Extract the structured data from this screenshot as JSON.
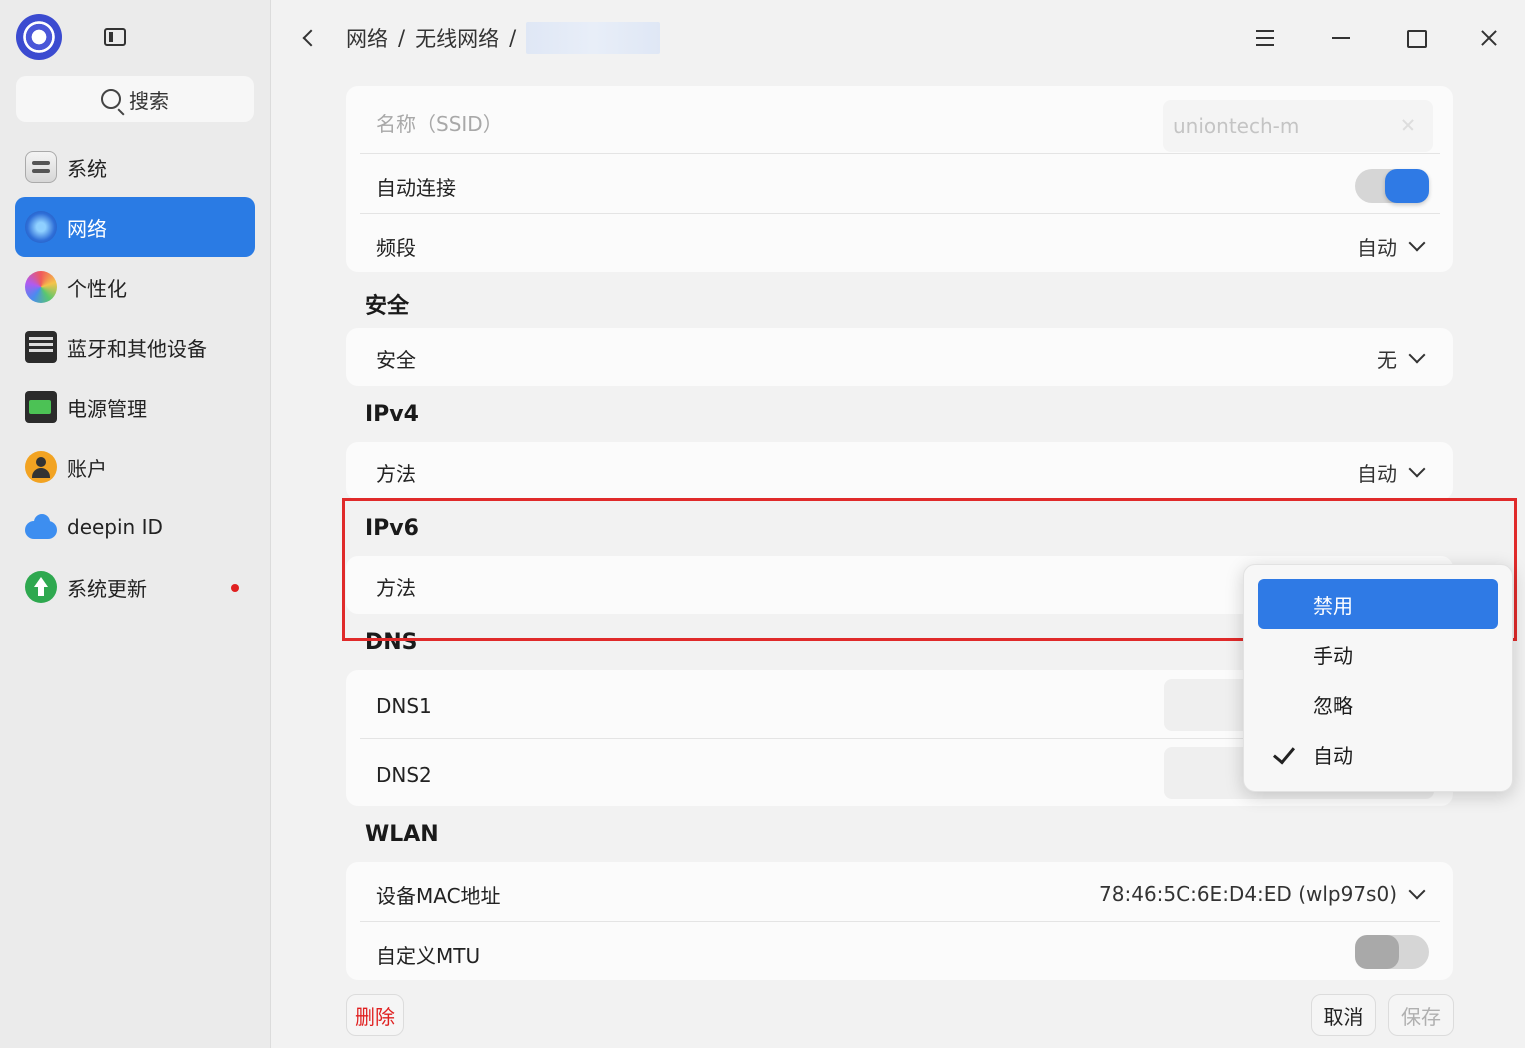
{
  "sidebar": {
    "search_label": "搜索",
    "items": [
      {
        "label": "系统"
      },
      {
        "label": "网络"
      },
      {
        "label": "个性化"
      },
      {
        "label": "蓝牙和其他设备"
      },
      {
        "label": "电源管理"
      },
      {
        "label": "账户"
      },
      {
        "label": "deepin ID"
      },
      {
        "label": "系统更新"
      }
    ]
  },
  "breadcrumb": {
    "part1": "网络",
    "sep": "/",
    "part2": "无线网络"
  },
  "general": {
    "ssid_label": "名称（SSID）",
    "ssid_value": "uniontech-m",
    "auto_connect_label": "自动连接",
    "auto_connect_on": true,
    "band_label": "频段",
    "band_value": "自动"
  },
  "security": {
    "title": "安全",
    "label": "安全",
    "value": "无"
  },
  "ipv4": {
    "title": "IPv4",
    "method_label": "方法",
    "method_value": "自动"
  },
  "ipv6": {
    "title": "IPv6",
    "method_label": "方法"
  },
  "dns": {
    "title": "DNS",
    "dns1_label": "DNS1",
    "dns2_label": "DNS2"
  },
  "wlan": {
    "title": "WLAN",
    "mac_label": "设备MAC地址",
    "mac_value": "78:46:5C:6E:D4:ED (wlp97s0)",
    "mtu_label": "自定义MTU",
    "mtu_on": false
  },
  "dropdown": {
    "options": [
      {
        "label": "禁用",
        "highlighted": true,
        "checked": false
      },
      {
        "label": "手动",
        "highlighted": false,
        "checked": false
      },
      {
        "label": "忽略",
        "highlighted": false,
        "checked": false
      },
      {
        "label": "自动",
        "highlighted": false,
        "checked": true
      }
    ]
  },
  "buttons": {
    "delete": "删除",
    "cancel": "取消",
    "save": "保存"
  },
  "colors": {
    "accent": "#2a7be4",
    "highlight_box": "#e02a2a",
    "danger": "#e02020"
  }
}
